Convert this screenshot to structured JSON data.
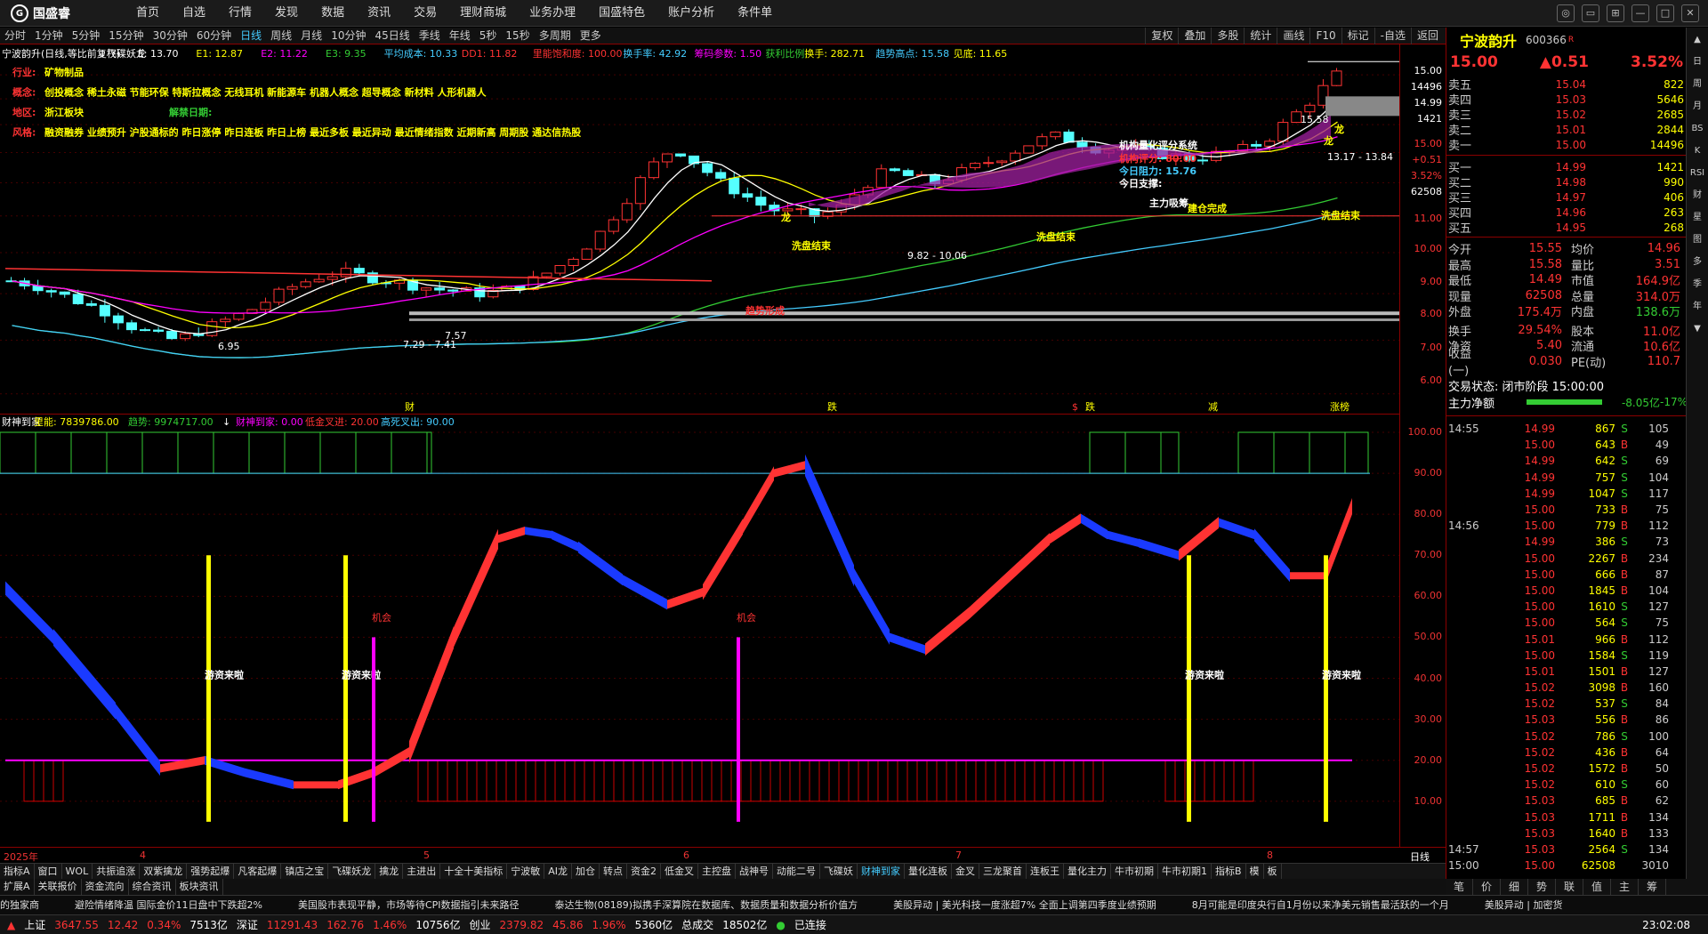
{
  "app": {
    "logo_text": "国盛睿",
    "logo_mark": "G"
  },
  "menu": [
    "首页",
    "自选",
    "行情",
    "发现",
    "数据",
    "资讯",
    "交易",
    "理财商城",
    "业务办理",
    "国盛特色",
    "账户分析",
    "条件单"
  ],
  "window_controls": [
    "comment-icon",
    "message-icon",
    "layout-icon",
    "minimize-icon",
    "maximize-icon",
    "close-icon"
  ],
  "periods": [
    "分时",
    "1分钟",
    "5分钟",
    "15分钟",
    "30分钟",
    "60分钟",
    "日线",
    "周线",
    "月线",
    "10分钟",
    "45日线",
    "季线",
    "年线",
    "5秒",
    "15秒",
    "多周期",
    "更多"
  ],
  "active_period": "日线",
  "chart_tools": [
    "复权",
    "叠加",
    "多股",
    "统计",
    "画线",
    "F10",
    "标记",
    "-自选",
    "返回"
  ],
  "main_legend": [
    {
      "t": "宁波韵升(日线,等比前复权)",
      "c": "#fff"
    },
    {
      "t": "↓飞碟妖龙",
      "c": "#fff"
    },
    {
      "t": "E: 13.70",
      "c": "#fff"
    },
    {
      "t": "E1: 12.87",
      "c": "#ff0"
    },
    {
      "t": "E2: 11.22",
      "c": "#f0f"
    },
    {
      "t": "E3: 9.35",
      "c": "#3c3"
    },
    {
      "t": "平均成本: 10.33",
      "c": "#4cf"
    },
    {
      "t": "DD1: 11.82",
      "c": "#f33"
    },
    {
      "t": "里能饱和度: 100.00",
      "c": "#f33"
    },
    {
      "t": "换手率: 42.92",
      "c": "#4cf"
    },
    {
      "t": "筹码参数: 1.50",
      "c": "#f0f"
    },
    {
      "t": "获利比例:",
      "c": "#3c3"
    },
    {
      "t": "换手: 282.71",
      "c": "#ff0"
    },
    {
      "t": "趋势高点: 15.58",
      "c": "#4cf"
    },
    {
      "t": "见底: 11.65",
      "c": "#ff0"
    }
  ],
  "info_lines": [
    {
      "label": "行业:",
      "text": "矿物制品",
      "extra": ""
    },
    {
      "label": "概念:",
      "text": "创投概念 稀土永磁 节能环保 特斯拉概念 无线耳机 新能源车 机器人概念 超导概念 新材料 人形机器人",
      "extra": ""
    },
    {
      "label": "地区:",
      "text": "浙江板块",
      "extra": "解禁日期:"
    },
    {
      "label": "风格:",
      "text": "融资融券 业绩预升 沪股通标的 昨日涨停 昨日连板 昨日上榜 最近多板 最近异动 最近情绪指数 近期新高 周期股 通达信热股",
      "extra": ""
    }
  ],
  "score_box": {
    "title": "机构量化评分系统",
    "score": "机构评分: 80.00",
    "today_force": "今日阻力: 15.76",
    "today_support": "今日支撑:",
    "desc": "主力吸筹"
  },
  "annotations": [
    "洗盘结束",
    "龙",
    "洗盘结束",
    "建仓完成",
    "洗盘结束",
    "主力吸筹",
    "龙",
    "龙",
    "趋势形成"
  ],
  "price_labels": [
    "15.58",
    "13.17 - 13.84",
    "6.95",
    "7.29 - 7.41",
    "7.57",
    "9.82 - 10.06"
  ],
  "bottom_markers": [
    "财",
    "跌",
    "$",
    "跌",
    "减",
    "涨榜"
  ],
  "y1": {
    "levels": [
      "15.00",
      "14496",
      "14.99",
      "1421",
      "15.00",
      "+0.51",
      "3.52%",
      "62508",
      "11.00",
      "10.00",
      "9.00",
      "8.00",
      "7.00",
      "6.00"
    ]
  },
  "ind_legend": [
    {
      "t": "财神到家",
      "c": "#fff"
    },
    {
      "t": "里能: 7839786.00",
      "c": "#ff0"
    },
    {
      "t": "趋势: 9974717.00",
      "c": "#3c3"
    },
    {
      "t": "↓",
      "c": "#fff"
    },
    {
      "t": "财神到家: 0.00",
      "c": "#f0f"
    },
    {
      "t": "低金叉进: 20.00",
      "c": "#f33"
    },
    {
      "t": "高死叉出: 90.00",
      "c": "#4cf"
    }
  ],
  "ind_marks": {
    "signal": "游资来啦",
    "chance": "机会"
  },
  "y2": {
    "levels": [
      "100.00",
      "90.00",
      "80.00",
      "70.00",
      "60.00",
      "50.00",
      "40.00",
      "30.00",
      "20.00",
      "10.00"
    ]
  },
  "x_labels": [
    "2025年",
    "4",
    "5",
    "6",
    "7",
    "8"
  ],
  "x_right": "日线",
  "tabs": [
    "指标A",
    "窗口",
    "WOL",
    "共振追涨",
    "双紫擒龙",
    "强势起爆",
    "凡客起爆",
    "镇店之宝",
    "飞碟妖龙",
    "擒龙",
    "主进出",
    "十全十美指标",
    "宁波敏",
    "AI龙",
    "加仓",
    "转点",
    "资金2",
    "低金叉",
    "主控盘",
    "战神号",
    "动能二号",
    "飞碟妖",
    "财神到家",
    "量化连板",
    "金叉",
    "三龙聚首",
    "连板王",
    "量化主力",
    "牛市初期",
    "牛市初期1",
    "指标B",
    "模",
    "板"
  ],
  "active_tab": "财神到家",
  "subtabs": [
    "扩展A",
    "关联报价",
    "资金流向",
    "综合资讯",
    "板块资讯"
  ],
  "news": [
    "的独家商",
    "避险情绪降温 国际金价11日盘中下跌超2%",
    "美国股市表现平静，市场等待CPI数据指引未来路径",
    "泰达生物(08189)拟携手深算院在数据库、数据质量和数据分析价值方",
    "美股异动 | 美光科技一度涨超7% 全面上调第四季度业绩预期",
    "8月可能是印度央行自1月份以来净美元销售最活跃的一个月",
    "美股异动 | 加密货"
  ],
  "status": [
    {
      "label": "上证",
      "v1": "3647.55",
      "v2": "12.42",
      "v3": "0.34%",
      "v4": "7513亿"
    },
    {
      "label": "深证",
      "v1": "11291.43",
      "v2": "162.76",
      "v3": "1.46%",
      "v4": "10756亿"
    },
    {
      "label": "创业",
      "v1": "2379.82",
      "v2": "45.86",
      "v3": "1.96%",
      "v4": "5360亿"
    }
  ],
  "total": {
    "label": "总成交",
    "value": "18502亿"
  },
  "connection": "已连接",
  "clock": "23:02:08",
  "stock": {
    "name": "宁波韵升",
    "code": "600366",
    "tag": "R",
    "price": "15.00",
    "change": "▲0.51",
    "pct": "3.52%"
  },
  "asks": [
    {
      "l": "卖五",
      "p": "15.04",
      "v": "822"
    },
    {
      "l": "卖四",
      "p": "15.03",
      "v": "5646"
    },
    {
      "l": "卖三",
      "p": "15.02",
      "v": "2685"
    },
    {
      "l": "卖二",
      "p": "15.01",
      "v": "2844"
    },
    {
      "l": "卖一",
      "p": "15.00",
      "v": "14496"
    }
  ],
  "bids": [
    {
      "l": "买一",
      "p": "14.99",
      "v": "1421"
    },
    {
      "l": "买二",
      "p": "14.98",
      "v": "990"
    },
    {
      "l": "买三",
      "p": "14.97",
      "v": "406"
    },
    {
      "l": "买四",
      "p": "14.96",
      "v": "263"
    },
    {
      "l": "买五",
      "p": "14.95",
      "v": "268"
    }
  ],
  "stats": [
    [
      "今开",
      "15.55",
      "均价",
      "14.96"
    ],
    [
      "最高",
      "15.58",
      "量比",
      "3.51"
    ],
    [
      "最低",
      "14.49",
      "市值",
      "164.9亿"
    ],
    [
      "现量",
      "62508",
      "总量",
      "314.0万"
    ],
    [
      "外盘",
      "175.4万",
      "内盘",
      "138.6万"
    ],
    [
      "换手",
      "29.54%",
      "股本",
      "11.0亿"
    ],
    [
      "净资",
      "5.40",
      "流通",
      "10.6亿"
    ],
    [
      "收益(一)",
      "0.030",
      "PE(动)",
      "110.7"
    ]
  ],
  "trade_status": "交易状态: 闭市阶段 15:00:00",
  "main_net": {
    "label": "主力净额",
    "value": "-8.05亿",
    "pct": "-17%"
  },
  "ticks": [
    [
      "14:55",
      "14.99",
      "867",
      "S",
      "105"
    ],
    [
      "",
      "15.00",
      "643",
      "B",
      "49"
    ],
    [
      "",
      "14.99",
      "642",
      "S",
      "69"
    ],
    [
      "",
      "14.99",
      "757",
      "S",
      "104"
    ],
    [
      "",
      "14.99",
      "1047",
      "S",
      "117"
    ],
    [
      "",
      "15.00",
      "733",
      "B",
      "75"
    ],
    [
      "14:56",
      "15.00",
      "779",
      "B",
      "112"
    ],
    [
      "",
      "14.99",
      "386",
      "S",
      "73"
    ],
    [
      "",
      "15.00",
      "2267",
      "B",
      "234"
    ],
    [
      "",
      "15.00",
      "666",
      "B",
      "87"
    ],
    [
      "",
      "15.00",
      "1845",
      "B",
      "104"
    ],
    [
      "",
      "15.00",
      "1610",
      "S",
      "127"
    ],
    [
      "",
      "15.00",
      "564",
      "S",
      "75"
    ],
    [
      "",
      "15.01",
      "966",
      "B",
      "112"
    ],
    [
      "",
      "15.00",
      "1584",
      "S",
      "119"
    ],
    [
      "",
      "15.01",
      "1501",
      "B",
      "127"
    ],
    [
      "",
      "15.02",
      "3098",
      "B",
      "160"
    ],
    [
      "",
      "15.02",
      "537",
      "S",
      "84"
    ],
    [
      "",
      "15.03",
      "556",
      "B",
      "86"
    ],
    [
      "",
      "15.02",
      "786",
      "S",
      "100"
    ],
    [
      "",
      "15.02",
      "436",
      "B",
      "64"
    ],
    [
      "",
      "15.02",
      "1572",
      "B",
      "50"
    ],
    [
      "",
      "15.02",
      "610",
      "S",
      "60"
    ],
    [
      "",
      "15.03",
      "685",
      "B",
      "62"
    ],
    [
      "",
      "15.03",
      "1711",
      "B",
      "134"
    ],
    [
      "",
      "15.03",
      "1640",
      "B",
      "133"
    ],
    [
      "14:57",
      "15.03",
      "2564",
      "S",
      "134"
    ],
    [
      "15:00",
      "15.00",
      "62508",
      "",
      "3010"
    ]
  ],
  "rside": [
    "up-arrow-icon",
    "日",
    "周",
    "月",
    "BS",
    "K",
    "RSI",
    "财",
    "星",
    "图",
    "多",
    "季",
    "年",
    "down-arrow-icon"
  ],
  "rbottom": [
    "笔",
    "价",
    "细",
    "势",
    "联",
    "值",
    "主",
    "筹"
  ],
  "colors": {
    "up": "#ff3333",
    "down": "#00ffff",
    "accent": "#4cf",
    "yellow": "#ffff00",
    "magenta": "#ff00ff",
    "green": "#33cc33"
  }
}
